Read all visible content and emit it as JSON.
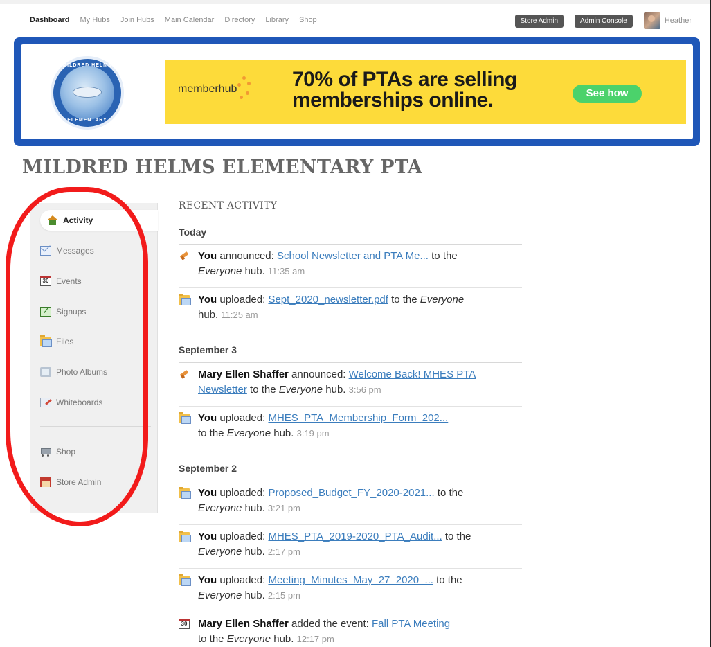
{
  "nav": {
    "links": [
      {
        "label": "Dashboard",
        "active": true
      },
      {
        "label": "My Hubs",
        "active": false
      },
      {
        "label": "Join Hubs",
        "active": false
      },
      {
        "label": "Main Calendar",
        "active": false
      },
      {
        "label": "Directory",
        "active": false
      },
      {
        "label": "Library",
        "active": false
      },
      {
        "label": "Shop",
        "active": false
      }
    ],
    "store_admin": "Store Admin",
    "admin_console": "Admin Console",
    "user_name": "Heather"
  },
  "banner": {
    "logo_top": "MILDRED HELMS",
    "logo_bottom": "ELEMENTARY",
    "ad_brand": "memberhub",
    "ad_headline_1": "70% of PTAs are selling",
    "ad_headline_2": "memberships online.",
    "ad_cta": "See how",
    "colors": {
      "frame": "#1f57b8",
      "ad_bg": "#fddb3a",
      "cta": "#4bd26b"
    }
  },
  "page_title": "MILDRED HELMS ELEMENTARY PTA",
  "sidebar": {
    "items": [
      {
        "label": "Activity",
        "icon": "home-icon",
        "active": true
      },
      {
        "label": "Messages",
        "icon": "mail-icon"
      },
      {
        "label": "Events",
        "icon": "calendar-icon",
        "badge": "30"
      },
      {
        "label": "Signups",
        "icon": "checkbox-icon"
      },
      {
        "label": "Files",
        "icon": "folder-icon"
      },
      {
        "label": "Photo Albums",
        "icon": "photo-album-icon"
      },
      {
        "label": "Whiteboards",
        "icon": "whiteboard-icon"
      },
      {
        "label": "Shop",
        "icon": "cart-icon"
      },
      {
        "label": "Store Admin",
        "icon": "store-icon"
      }
    ]
  },
  "feed": {
    "heading": "RECENT ACTIVITY",
    "days": [
      {
        "label": "Today",
        "items": [
          {
            "icon": "announce-icon",
            "actor": "You",
            "verb": " announced: ",
            "link": "School Newsletter and PTA Me...",
            "pre_hub": " to the ",
            "hub": "Everyone",
            "post_hub": " hub. ",
            "time": "11:35 am"
          },
          {
            "icon": "upload-icon",
            "actor": "You",
            "verb": " uploaded: ",
            "link": "Sept_2020_newsletter.pdf",
            "pre_hub": " to the ",
            "hub": "Everyone",
            "post_hub": " hub. ",
            "time": "11:25 am"
          }
        ]
      },
      {
        "label": "September 3",
        "items": [
          {
            "icon": "announce-icon",
            "actor": "Mary Ellen Shaffer",
            "verb": " announced: ",
            "link": "Welcome Back! MHES PTA Newsletter",
            "pre_hub": " to the ",
            "hub": "Everyone",
            "post_hub": " hub. ",
            "time": "3:56 pm"
          },
          {
            "icon": "upload-icon",
            "actor": "You",
            "verb": " uploaded: ",
            "link": "MHES_PTA_Membership_Form_202...",
            "pre_hub": " to the ",
            "hub": "Everyone",
            "post_hub": " hub. ",
            "time": "3:19 pm"
          }
        ]
      },
      {
        "label": "September 2",
        "items": [
          {
            "icon": "upload-icon",
            "actor": "You",
            "verb": " uploaded: ",
            "link": "Proposed_Budget_FY_2020-2021...",
            "pre_hub": " to the ",
            "hub": "Everyone",
            "post_hub": " hub. ",
            "time": "3:21 pm"
          },
          {
            "icon": "upload-icon",
            "actor": "You",
            "verb": " uploaded: ",
            "link": "MHES_PTA_2019-2020_PTA_Audit...",
            "pre_hub": " to the ",
            "hub": "Everyone",
            "post_hub": " hub. ",
            "time": "2:17 pm"
          },
          {
            "icon": "upload-icon",
            "actor": "You",
            "verb": " uploaded: ",
            "link": "Meeting_Minutes_May_27_2020_...",
            "pre_hub": " to the ",
            "hub": "Everyone",
            "post_hub": " hub. ",
            "time": "2:15 pm"
          },
          {
            "icon": "event-icon",
            "actor": "Mary Ellen Shaffer",
            "verb": " added the event: ",
            "link": "Fall PTA Meeting",
            "pre_hub": " to the ",
            "hub": "Everyone",
            "post_hub": " hub. ",
            "time": "12:17 pm",
            "badge": "30"
          }
        ]
      }
    ]
  },
  "annotation": {
    "ring_color": "#f21b1b"
  }
}
